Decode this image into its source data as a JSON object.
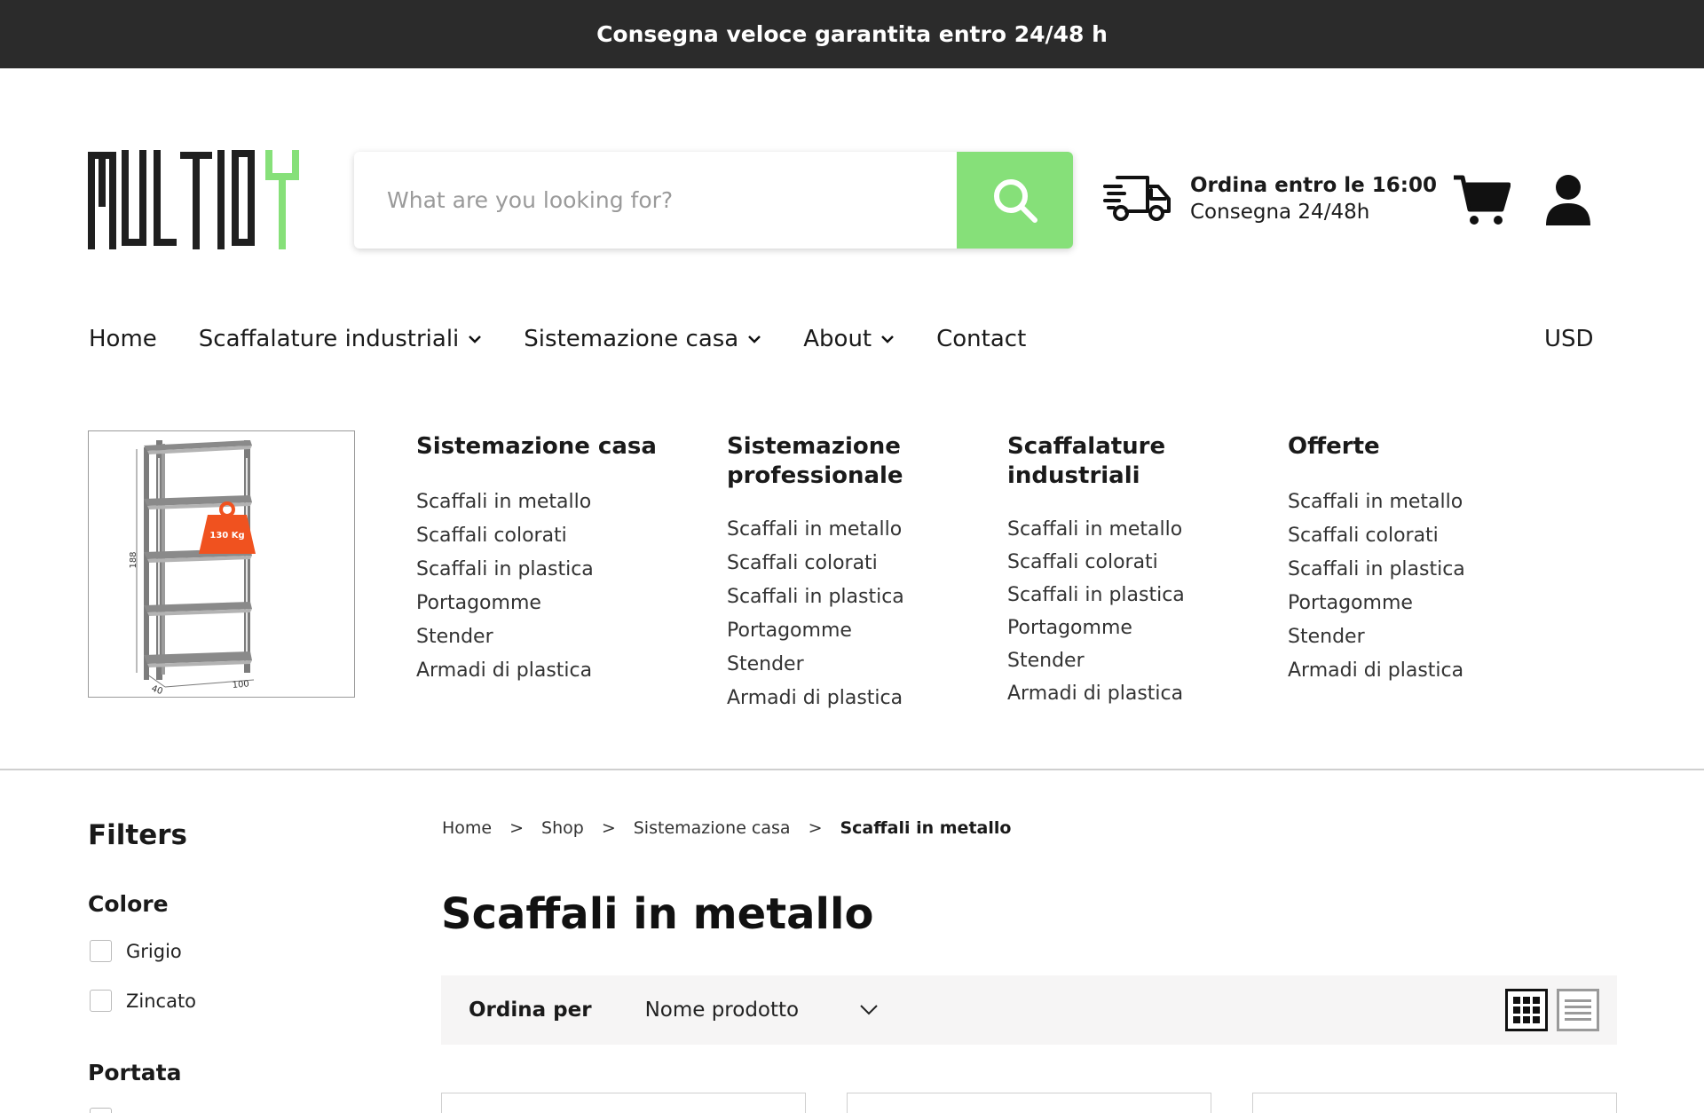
{
  "topbar": {
    "message": "Consegna veloce garantita entro 24/48 h"
  },
  "logo": {
    "text": "MULTIDY",
    "icon": "logo-y-green"
  },
  "search": {
    "placeholder": "What are you looking for?",
    "button_icon": "search-icon"
  },
  "delivery": {
    "line1": "Ordina entro le 16:00",
    "line2": "Consegna 24/48h",
    "icon": "truck-icon"
  },
  "header_icons": {
    "cart": "cart-icon",
    "account": "user-icon"
  },
  "nav": {
    "items": [
      {
        "label": "Home",
        "dropdown": false
      },
      {
        "label": "Scaffalature industriali",
        "dropdown": true
      },
      {
        "label": "Sistemazione casa",
        "dropdown": true
      },
      {
        "label": "About",
        "dropdown": true
      },
      {
        "label": "Contact",
        "dropdown": false
      }
    ],
    "currency": "USD"
  },
  "mega_menu": {
    "image": {
      "weight_label": "130 Kg",
      "height_label": "188",
      "depth_label": "40",
      "width_label": "100"
    },
    "columns": [
      {
        "title": "Sistemazione casa",
        "links": [
          "Scaffali in metallo",
          "Scaffali colorati",
          "Scaffali in plastica",
          "Portagomme",
          "Stender",
          "Armadi di plastica"
        ]
      },
      {
        "title": "Sistemazione professionale",
        "links": [
          "Scaffali in metallo",
          "Scaffali colorati",
          "Scaffali in plastica",
          "Portagomme",
          "Stender",
          "Armadi di plastica"
        ]
      },
      {
        "title": "Scaffalature industriali",
        "links": [
          "Scaffali in metallo",
          "Scaffali colorati",
          "Scaffali in plastica",
          "Portagomme",
          "Stender",
          "Armadi di plastica"
        ]
      },
      {
        "title": "Offerte",
        "links": [
          "Scaffali in metallo",
          "Scaffali colorati",
          "Scaffali in plastica",
          "Portagomme",
          "Stender",
          "Armadi di plastica"
        ]
      }
    ]
  },
  "filters": {
    "title": "Filters",
    "groups": [
      {
        "name": "Colore",
        "options": [
          "Grigio",
          "Zincato"
        ]
      },
      {
        "name": "Portata",
        "options": []
      }
    ]
  },
  "breadcrumb": {
    "items": [
      "Home",
      "Shop",
      "Sistemazione casa"
    ],
    "current": "Scaffali in metallo",
    "separator": ">"
  },
  "page": {
    "title": "Scaffali in metallo"
  },
  "sort": {
    "label": "Ordina per",
    "value": "Nome prodotto",
    "views": [
      "grid-view-icon",
      "list-view-icon"
    ],
    "active_view": "grid"
  },
  "colors": {
    "accent_green": "#86e079",
    "topbar_bg": "#2b2b2b",
    "sortbar_bg": "#f6f5f5",
    "badge_orange": "#f0521f"
  }
}
